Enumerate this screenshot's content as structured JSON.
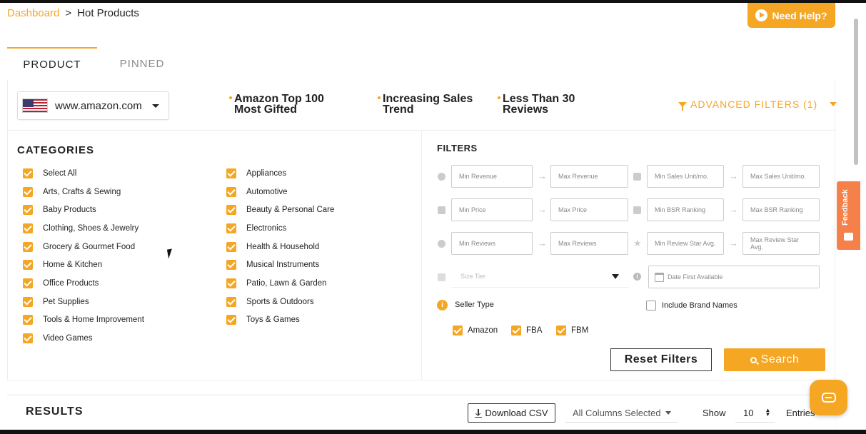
{
  "breadcrumb": {
    "link": "Dashboard",
    "separator": ">",
    "current": "Hot Products"
  },
  "help_button": "Need Help?",
  "tabs": [
    {
      "label": "PRODUCT",
      "active": true
    },
    {
      "label": "PINNED",
      "active": false
    }
  ],
  "marketplace": {
    "value": "www.amazon.com",
    "icon": "us-flag-icon"
  },
  "quick_filters": [
    {
      "line1": "Amazon Top 100",
      "line2": "Most Gifted"
    },
    {
      "line1": "Increasing Sales",
      "line2": "Trend"
    },
    {
      "line1": "Less Than 30",
      "line2": "Reviews"
    }
  ],
  "advanced_filters": "ADVANCED FILTERS (1)",
  "categories": {
    "title": "CATEGORIES",
    "col1": [
      "Select All",
      "Arts, Crafts & Sewing",
      "Baby Products",
      "Clothing, Shoes & Jewelry",
      "Grocery & Gourmet Food",
      "Home & Kitchen",
      "Office Products",
      "Pet Supplies",
      "Tools & Home Improvement",
      "Video Games"
    ],
    "col2": [
      "Appliances",
      "Automotive",
      "Beauty & Personal Care",
      "Electronics",
      "Health & Household",
      "Musical Instruments",
      "Patio, Lawn & Garden",
      "Sports & Outdoors",
      "Toys & Games"
    ]
  },
  "filters": {
    "title": "FILTERS",
    "rows": [
      [
        "Min Revenue",
        "Max Revenue",
        "Min Sales Unit/mo.",
        "Max Sales Unit/mo."
      ],
      [
        "Min Price",
        "Max Price",
        "Min BSR Ranking",
        "Max BSR Ranking"
      ],
      [
        "Min Reviews",
        "Max Reviews",
        "Min Review Star Avg.",
        "Max Review Star Avg."
      ]
    ],
    "size_tier_placeholder": "Size Tier",
    "date_placeholder": "Date First Available",
    "seller_type_label": "Seller Type",
    "seller_types": [
      "Amazon",
      "FBA",
      "FBM"
    ],
    "include_brand_label": "Include Brand Names",
    "reset_label": "Reset Filters",
    "search_label": "Search"
  },
  "results": {
    "title": "RESULTS",
    "csv_label": "Download CSV",
    "columns_label": "All Columns Selected",
    "show_label": "Show",
    "entries_value": "10",
    "entries_label": "Entries"
  },
  "feedback_label": "Feedback",
  "colors": {
    "accent": "#f5a623",
    "feedback": "#f5804a"
  }
}
